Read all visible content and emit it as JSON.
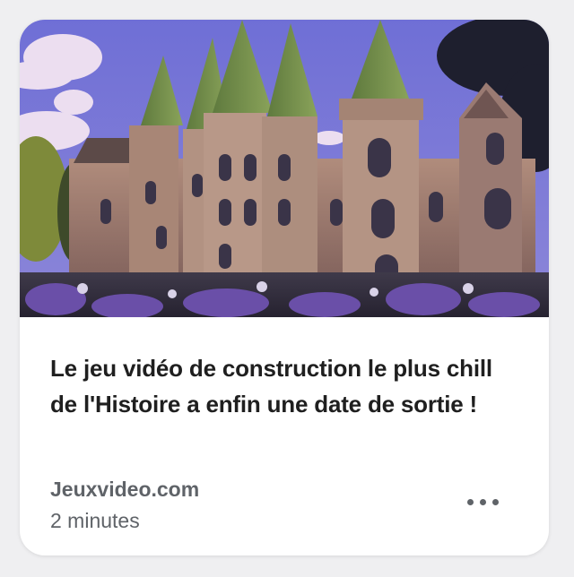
{
  "card": {
    "headline": "Le jeu vidéo de construction le plus chill de l'Histoire a enfin une date de sortie !",
    "source": "Jeuxvideo.com",
    "duration": "2 minutes",
    "more_icon": "more-horizontal-icon"
  },
  "colors": {
    "background": "#efeff1",
    "card": "#ffffff",
    "headline_text": "#1f1f1f",
    "meta_text": "#5f6368"
  }
}
